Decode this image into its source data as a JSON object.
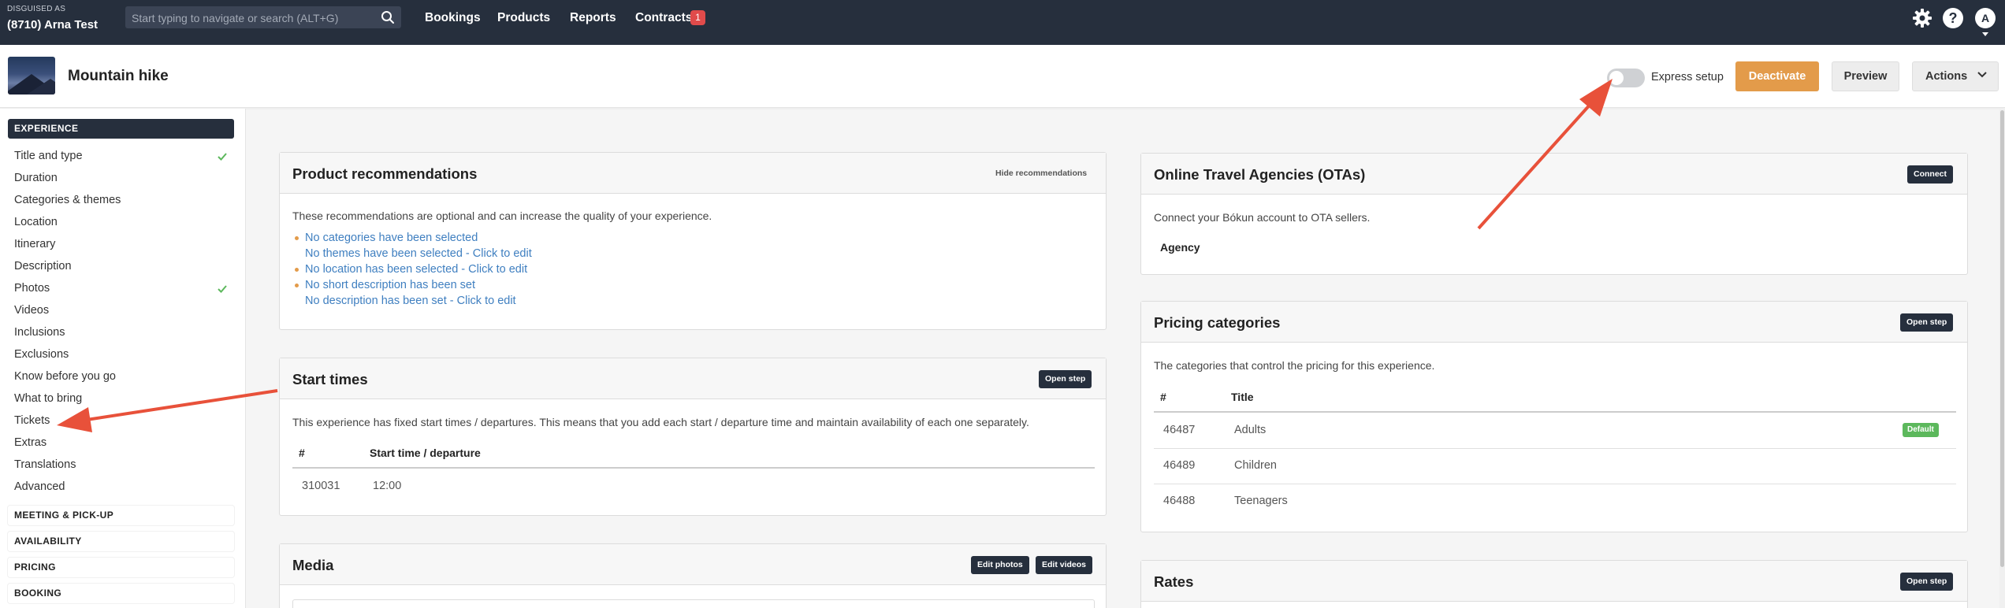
{
  "topbar": {
    "disguised_label": "DISGUISED AS",
    "account_name": "(8710) Arna Test",
    "search_placeholder": "Start typing to navigate or search (ALT+G)",
    "nav": [
      "Bookings",
      "Products",
      "Reports",
      "Contracts"
    ],
    "contracts_badge": "1",
    "help_label": "?",
    "avatar_initial": "A",
    "icons": [
      "search-icon",
      "gear-icon",
      "help-icon",
      "chevron-down-icon"
    ]
  },
  "header": {
    "title": "Mountain hike",
    "express_setup_label": "Express setup",
    "express_setup_on": false,
    "deactivate_label": "Deactivate",
    "preview_label": "Preview",
    "actions_label": "Actions"
  },
  "sidebar": {
    "experience_section": "EXPERIENCE",
    "items": [
      {
        "label": "Title and type",
        "checked": true
      },
      {
        "label": "Duration",
        "checked": false
      },
      {
        "label": "Categories & themes",
        "checked": false
      },
      {
        "label": "Location",
        "checked": false
      },
      {
        "label": "Itinerary",
        "checked": false
      },
      {
        "label": "Description",
        "checked": false
      },
      {
        "label": "Photos",
        "checked": true
      },
      {
        "label": "Videos",
        "checked": false
      },
      {
        "label": "Inclusions",
        "checked": false
      },
      {
        "label": "Exclusions",
        "checked": false
      },
      {
        "label": "Know before you go",
        "checked": false
      },
      {
        "label": "What to bring",
        "checked": false
      },
      {
        "label": "Tickets",
        "checked": false
      },
      {
        "label": "Extras",
        "checked": false
      },
      {
        "label": "Translations",
        "checked": false
      },
      {
        "label": "Advanced",
        "checked": false
      }
    ],
    "sections": [
      "MEETING & PICK-UP",
      "AVAILABILITY",
      "PRICING",
      "BOOKING"
    ]
  },
  "recommendations": {
    "title": "Product recommendations",
    "hide_label": "Hide recommendations",
    "intro": "These recommendations are optional and can increase the quality of your experience.",
    "items": [
      "No categories have been selected",
      "No themes have been selected - Click to edit",
      "No location has been selected - Click to edit",
      "No short description has been set",
      "No description has been set - Click to edit"
    ]
  },
  "start_times": {
    "title": "Start times",
    "open_step_label": "Open step",
    "description": "This experience has fixed start times / departures. This means that you add each start / departure time and maintain availability of each one separately.",
    "columns": [
      "#",
      "Start time / departure"
    ],
    "rows": [
      [
        "310031",
        "12:00"
      ]
    ]
  },
  "media": {
    "title": "Media",
    "edit_photos_label": "Edit photos",
    "edit_videos_label": "Edit videos"
  },
  "otas": {
    "title": "Online Travel Agencies (OTAs)",
    "connect_label": "Connect",
    "description": "Connect your Bókun account to OTA sellers.",
    "agency_header": "Agency"
  },
  "pricing_categories": {
    "title": "Pricing categories",
    "open_step_label": "Open step",
    "description": "The categories that control the pricing for this experience.",
    "columns": [
      "#",
      "Title"
    ],
    "rows": [
      {
        "id": "46487",
        "title": "Adults",
        "badge": "Default"
      },
      {
        "id": "46489",
        "title": "Children",
        "badge": ""
      },
      {
        "id": "46488",
        "title": "Teenagers",
        "badge": ""
      }
    ]
  },
  "rates": {
    "title": "Rates",
    "open_step_label": "Open step"
  },
  "colors": {
    "navbar": "#262f3d",
    "accent_orange": "#e39b4a",
    "link_blue": "#3f7fc0",
    "success_green": "#5cb85c",
    "alert_red": "#e04b4b",
    "annotation_arrow": "#e8513a"
  }
}
